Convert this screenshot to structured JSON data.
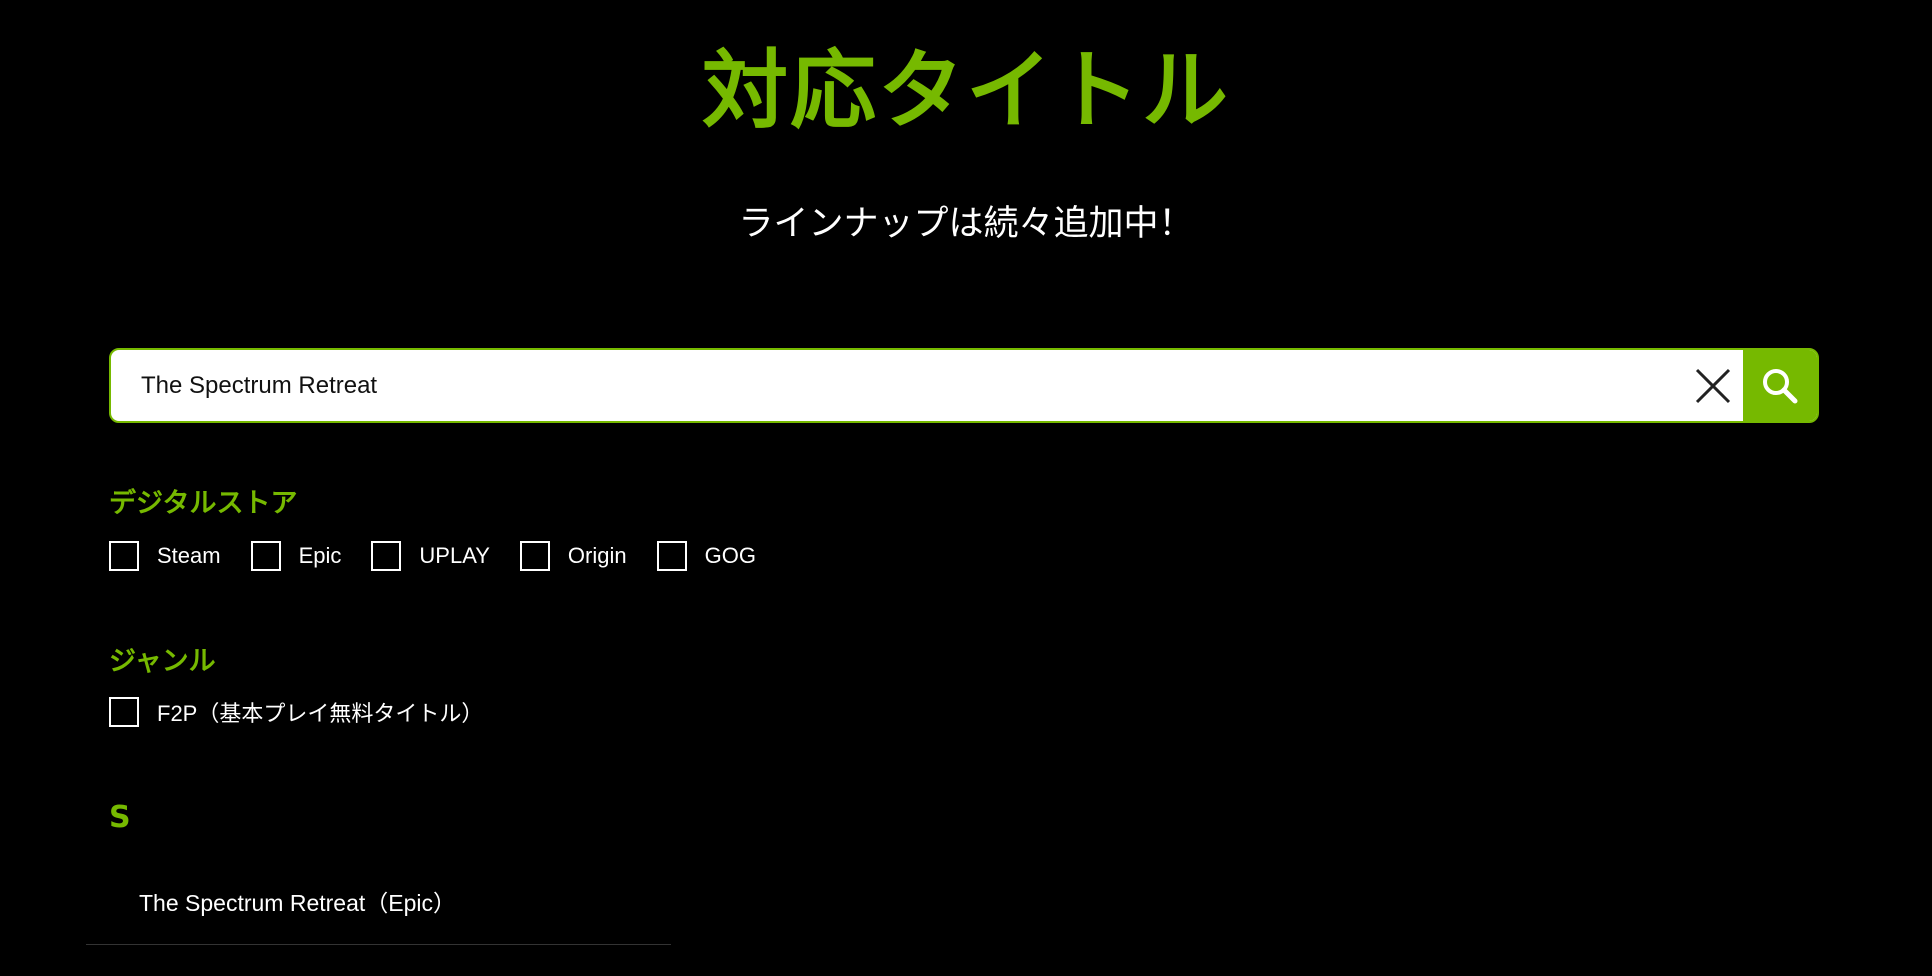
{
  "header": {
    "title": "対応タイトル",
    "subtitle": "ラインナップは続々追加中！"
  },
  "search": {
    "value": "The Spectrum Retreat",
    "clear_icon": "close-icon",
    "search_icon": "search-icon"
  },
  "filters": {
    "store": {
      "heading": "デジタルストア",
      "options": [
        {
          "label": "Steam",
          "checked": false
        },
        {
          "label": "Epic",
          "checked": false
        },
        {
          "label": "UPLAY",
          "checked": false
        },
        {
          "label": "Origin",
          "checked": false
        },
        {
          "label": "GOG",
          "checked": false
        }
      ]
    },
    "genre": {
      "heading": "ジャンル",
      "options": [
        {
          "label": "F2P（基本プレイ無料タイトル）",
          "checked": false
        }
      ]
    }
  },
  "results": {
    "letter": "S",
    "items": [
      {
        "label": "The Spectrum Retreat（Epic）"
      }
    ]
  },
  "colors": {
    "accent": "#76b900",
    "background": "#000000",
    "text": "#ffffff"
  }
}
